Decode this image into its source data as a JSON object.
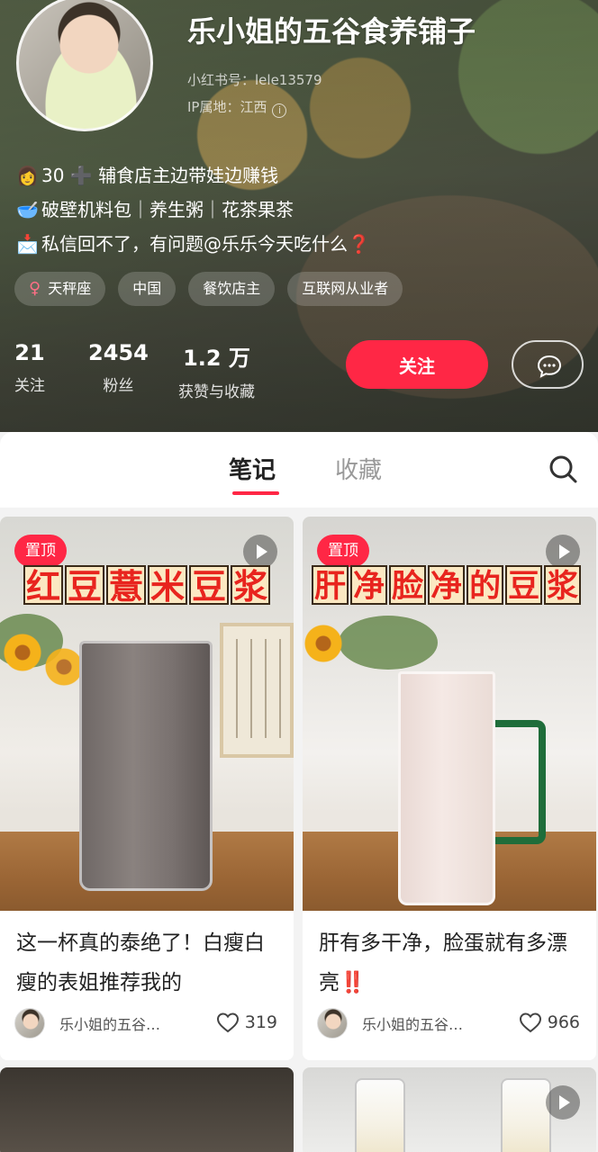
{
  "profile": {
    "name": "乐小姐的五谷食养铺子",
    "id_line": "小红书号：lele13579",
    "ip_line": "IP属地：江西",
    "bio": [
      {
        "emoji": "👩",
        "text": "30 ➕ 辅食店主边带娃边赚钱"
      },
      {
        "emoji": "🥣",
        "text": "破壁机料包｜养生粥｜花茶果茶"
      },
      {
        "emoji": "📩",
        "text": "私信回不了，有问题@乐乐今天吃什么",
        "suffix": "❓"
      }
    ],
    "tags": [
      "天秤座",
      "中国",
      "餐饮店主",
      "互联网从业者"
    ],
    "stats": [
      {
        "value": "21",
        "label": "关注"
      },
      {
        "value": "2454",
        "label": "粉丝"
      },
      {
        "value": "1.2 万",
        "label": "获赞与收藏"
      }
    ],
    "follow_label": "关注"
  },
  "tabs": [
    {
      "label": "笔记",
      "active": true
    },
    {
      "label": "收藏",
      "active": false
    }
  ],
  "notes": [
    {
      "pin_label": "置顶",
      "cover_text": [
        "红",
        "豆",
        "薏",
        "米",
        "豆",
        "浆"
      ],
      "title": "这一杯真的泰绝了！白瘦白瘦的表姐推荐我的",
      "author": "乐小姐的五谷…",
      "likes": "319"
    },
    {
      "pin_label": "置顶",
      "cover_text": [
        "肝",
        "净",
        "脸",
        "净",
        "的",
        "豆",
        "浆"
      ],
      "title": "肝有多干净，脸蛋就有多漂亮",
      "title_suffix": "‼️",
      "author": "乐小姐的五谷…",
      "likes": "966"
    }
  ],
  "colors": {
    "accent": "#ff2745"
  },
  "icons": [
    "female-icon",
    "info-icon",
    "message-icon",
    "search-icon",
    "play-icon",
    "heart-icon"
  ]
}
